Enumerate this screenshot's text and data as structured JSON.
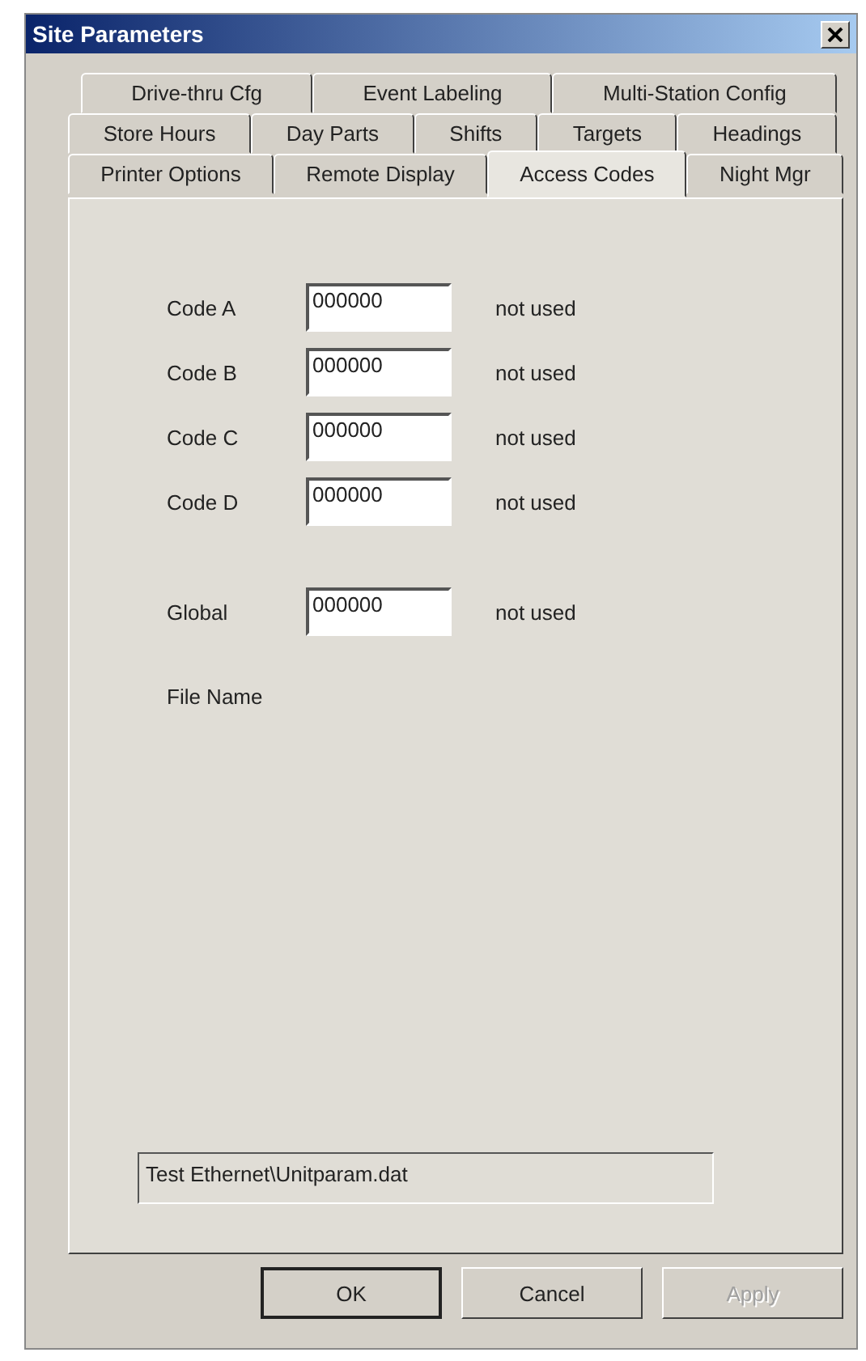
{
  "window": {
    "title": "Site Parameters"
  },
  "tab_rows": [
    [
      {
        "label": "Drive-thru Cfg",
        "selected": false
      },
      {
        "label": "Event Labeling",
        "selected": false
      },
      {
        "label": "Multi-Station Config",
        "selected": false
      }
    ],
    [
      {
        "label": "Store Hours",
        "selected": false
      },
      {
        "label": "Day Parts",
        "selected": false
      },
      {
        "label": "Shifts",
        "selected": false
      },
      {
        "label": "Targets",
        "selected": false
      },
      {
        "label": "Headings",
        "selected": false
      }
    ],
    [
      {
        "label": "Printer Options",
        "selected": false
      },
      {
        "label": "Remote Display",
        "selected": false
      },
      {
        "label": "Access Codes",
        "selected": true
      },
      {
        "label": "Night Mgr",
        "selected": false
      }
    ]
  ],
  "codes": [
    {
      "label": "Code A",
      "value": "000000",
      "status": "not used"
    },
    {
      "label": "Code B",
      "value": "000000",
      "status": "not used"
    },
    {
      "label": "Code C",
      "value": "000000",
      "status": "not used"
    },
    {
      "label": "Code D",
      "value": "000000",
      "status": "not used"
    },
    {
      "label": "Global",
      "value": "000000",
      "status": "not used"
    }
  ],
  "file_name": {
    "label": "File Name",
    "value": "Test Ethernet\\Unitparam.dat"
  },
  "buttons": [
    {
      "label": "OK",
      "disabled": false
    },
    {
      "label": "Cancel",
      "disabled": false
    },
    {
      "label": "Apply",
      "disabled": true
    }
  ]
}
